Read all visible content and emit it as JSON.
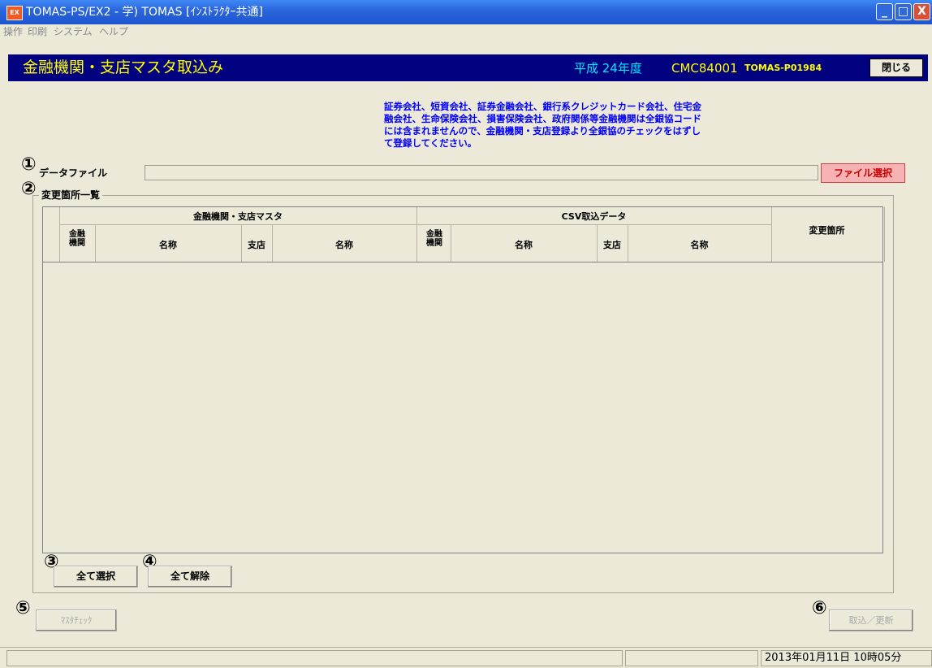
{
  "window": {
    "app_icon_text": "EX",
    "title": "TOMAS-PS/EX2 - 学) TOMAS [ｲﾝｽﾄﾗｸﾀｰ共通]",
    "min": "_",
    "max": "□",
    "close": "X"
  },
  "menu": [
    "操作",
    "印刷",
    "システム",
    "ヘルプ"
  ],
  "header": {
    "title": "金融機関・支店マスタ取込み",
    "era_year": "平成 24年度",
    "screen_code": "CMC84001",
    "program_id": "TOMAS-P01984",
    "close_button": "閉じる"
  },
  "notice": [
    "証券会社、短資会社、証券金融会社、銀行系クレジットカード会社、住宅金",
    "融会社、生命保険会社、損害保険会社、政府関係等金融機関は全銀協コード",
    "には含まれませんので、金融機関・支店登録より全銀協のチェックをはずし",
    "て登録してください。"
  ],
  "markers": [
    "①",
    "②",
    "③",
    "④",
    "⑤",
    "⑥"
  ],
  "data_file": {
    "label": "データファイル",
    "value": "",
    "select_button": "ファイル選択"
  },
  "changes": {
    "group_label": "変更箇所一覧",
    "grid": {
      "group_master": "金融機関・支店マスタ",
      "group_csv": "CSV取込データ",
      "col_bank": "金融機関",
      "col_name": "名称",
      "col_branch": "支店",
      "col_changed": "変更箇所"
    },
    "select_all": "全て選択",
    "deselect_all": "全て解除"
  },
  "actions": {
    "master_check": "ﾏｽﾀﾁｪｯｸ",
    "import_update": "取込／更新"
  },
  "status": {
    "datetime": "2013年01月11日 10時05分"
  },
  "colors": {
    "header_bg": "#020280",
    "title_yellow": "#ffff00",
    "era_cyan": "#00e8ff",
    "notice_blue": "#0000ff",
    "file_button_bg": "#f7b3b3"
  }
}
